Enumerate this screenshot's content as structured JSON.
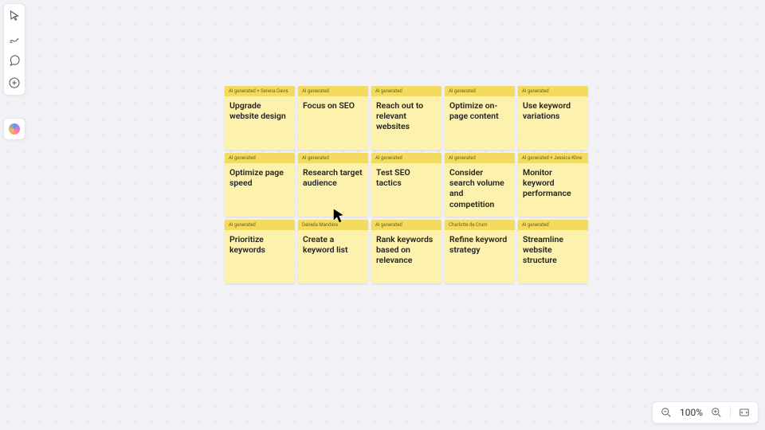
{
  "zoom": {
    "level": "100%"
  },
  "notes": [
    {
      "author": "AI generated + Serena Davis",
      "text": "Upgrade website design"
    },
    {
      "author": "AI generated",
      "text": "Focus on SEO"
    },
    {
      "author": "AI generated",
      "text": "Reach out to relevant websites"
    },
    {
      "author": "AI generated",
      "text": "Optimize on-page content"
    },
    {
      "author": "AI generated",
      "text": "Use keyword variations"
    },
    {
      "author": "AI generated",
      "text": "Optimize page speed"
    },
    {
      "author": "AI generated",
      "text": "Research target audience"
    },
    {
      "author": "AI generated",
      "text": "Test SEO tactics"
    },
    {
      "author": "AI generated",
      "text": "Consider search volume and competition"
    },
    {
      "author": "AI generated + Jessica Kline",
      "text": "Monitor keyword performance"
    },
    {
      "author": "AI generated",
      "text": "Prioritize keywords"
    },
    {
      "author": "Daniela Mandera",
      "text": "Create a keyword list"
    },
    {
      "author": "AI generated",
      "text": "Rank keywords based on relevance"
    },
    {
      "author": "Charlotte de Crum",
      "text": "Refine keyword strategy"
    },
    {
      "author": "AI generated",
      "text": "Streamline website structure"
    }
  ]
}
